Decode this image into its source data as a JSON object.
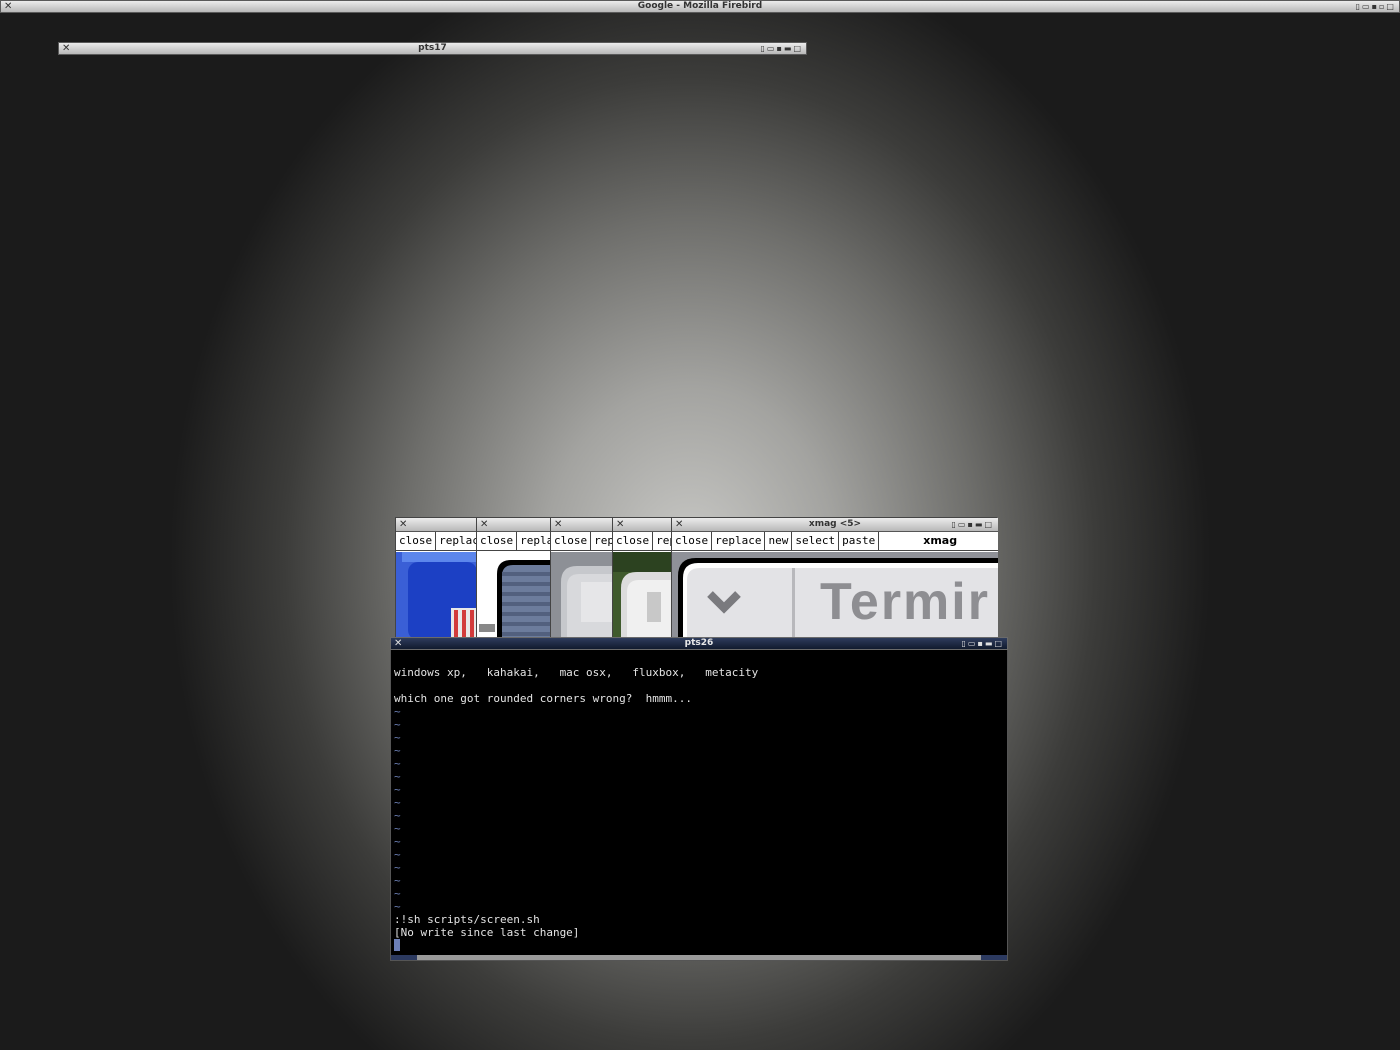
{
  "top_window": {
    "title": "Google - Mozilla Firebird"
  },
  "pts17_window": {
    "title": "pts17"
  },
  "xmag_group": {
    "title": "xmag <5>",
    "panes": [
      {
        "close": "close",
        "replace": "replac"
      },
      {
        "close": "close",
        "replace": "repla"
      },
      {
        "close": "close",
        "replace": "rep"
      },
      {
        "close": "close",
        "replace": "rep"
      }
    ],
    "main_pane": {
      "close": "close",
      "replace": "replace",
      "new": "new",
      "select": "select",
      "paste": "paste",
      "label": "xmag",
      "magnified_text": "Termir"
    }
  },
  "terminal": {
    "title": "pts26",
    "line1": "windows xp,   kahakai,   mac osx,   fluxbox,   metacity",
    "line2": "which one got rounded corners wrong?  hmmm...",
    "tilde_char": "~",
    "command": ":!sh scripts/screen.sh",
    "status": "[No write since last change]"
  }
}
